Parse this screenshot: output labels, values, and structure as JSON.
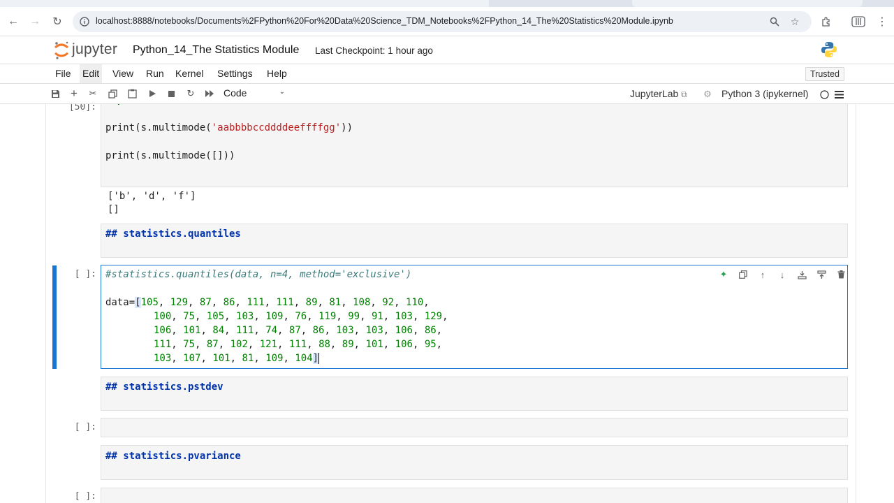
{
  "browser": {
    "url": "localhost:8888/notebooks/Documents%2FPython%20For%20Data%20Science_TDM_Notebooks%2FPython_14_The%20Statistics%20Module.ipynb"
  },
  "header": {
    "logo_text": "jupyter",
    "notebook_title": "Python_14_The Statistics Module",
    "checkpoint": "Last Checkpoint: 1 hour ago"
  },
  "menubar": {
    "items": [
      "File",
      "Edit",
      "View",
      "Run",
      "Kernel",
      "Settings",
      "Help"
    ],
    "trusted": "Trusted"
  },
  "toolbar": {
    "cell_type": "Code",
    "jupyterlab_link": "JupyterLab",
    "kernel": "Python 3 (ipykernel)"
  },
  "cells": {
    "c1": {
      "prompt": "[50]:",
      "lines": [
        "import statistics as s",
        "print(s.multimode('aabbbbccddddeeffffgg'))",
        "print(s.multimode([]))"
      ],
      "output": [
        "['b', 'd', 'f']",
        "[]"
      ]
    },
    "c2": {
      "markdown": "## statistics.quantiles"
    },
    "c3": {
      "prompt": "[ ]:",
      "comment": "#statistics.quantiles(data, n=4, method='exclusive')",
      "data_lines": [
        "data=[105, 129, 87, 86, 111, 111, 89, 81, 108, 92, 110,",
        "100, 75, 105, 103, 109, 76, 119, 99, 91, 103, 129,",
        "106, 101, 84, 111, 74, 87, 86, 103, 103, 106, 86,",
        "111, 75, 87, 102, 121, 111, 88, 89, 101, 106, 95,",
        "103, 107, 101, 81, 109, 104]"
      ]
    },
    "c4": {
      "markdown": "## statistics.pstdev"
    },
    "c5": {
      "prompt": "[ ]:"
    },
    "c6": {
      "markdown": "## statistics.pvariance"
    },
    "c7": {
      "prompt": "[ ]:"
    }
  },
  "colors": {
    "accent": "#1976d2",
    "keyword": "#008000",
    "string": "#ba2121",
    "comment": "#3d7b7b",
    "markdown_heading": "#0033aa"
  }
}
